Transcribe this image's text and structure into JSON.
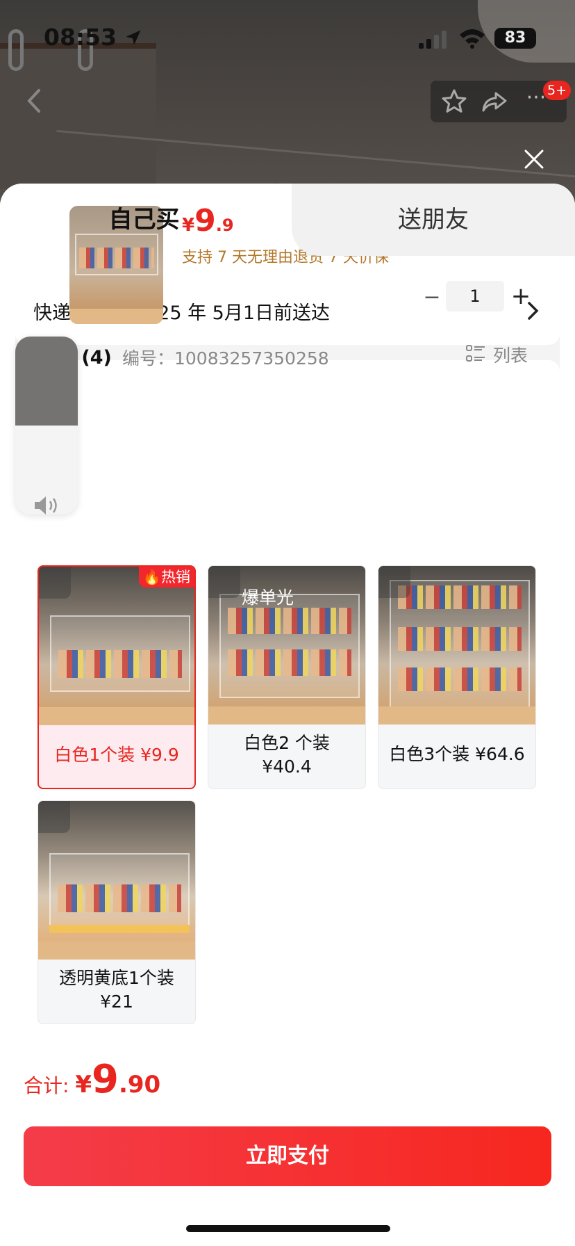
{
  "status_bar": {
    "time": "08:53",
    "battery": "83"
  },
  "nav": {
    "badge": "5+",
    "more": "···"
  },
  "tabs": [
    {
      "label": "自己买"
    },
    {
      "label": "送朋友"
    }
  ],
  "shipping": {
    "text": "快递运输 预计 25 年 5月1日前送达"
  },
  "product": {
    "price_currency": "¥",
    "price_int": "9",
    "price_dec": ".9",
    "guarantee": "支持 7 天无理由退货   7 天价保",
    "quantity": "1",
    "qty_minus": "−",
    "qty_plus": "+"
  },
  "spec": {
    "title": "八寸 (4)",
    "code_label": "编号：10083257350258",
    "list_label": "列表"
  },
  "variants": [
    {
      "label": "白色1个装 ¥9.9",
      "badge": "热销",
      "selected": true
    },
    {
      "label_line1": "白色2 个装",
      "label_line2": "¥40.4",
      "tag": "爆单光",
      "selected": false
    },
    {
      "label": "白色3个装 ¥64.6",
      "selected": false
    },
    {
      "label_line1": "透明黄底1个装",
      "label_line2": "¥21",
      "selected": false
    }
  ],
  "volume": {
    "level": 0.5
  },
  "total": {
    "label": "合计: ",
    "currency": "¥",
    "int": "9",
    "dec": ".90"
  },
  "pay_button": {
    "label": "立即支付"
  },
  "colors": {
    "accent": "#e8261f",
    "guarantee": "#b3782a",
    "hot": "#f2272d"
  }
}
